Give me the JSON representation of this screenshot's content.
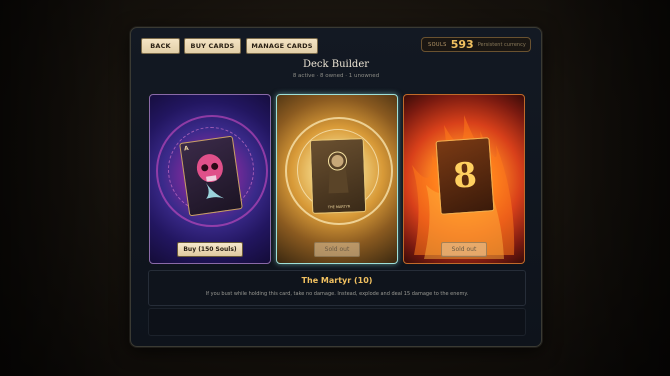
{
  "topbar": {
    "back_label": "BACK",
    "buy_label": "BUY CARDS",
    "manage_label": "MANAGE CARDS"
  },
  "souls": {
    "label": "SOULS",
    "count": "593",
    "currency_note": "Persistent currency"
  },
  "header": {
    "title": "Deck Builder",
    "subtitle": "8 active · 8 owned · 1 unowned"
  },
  "cards": [
    {
      "art": "skull-spirit-card",
      "button_label": "Buy (150 Souls)",
      "state": "buy",
      "rank": "A"
    },
    {
      "art": "martyr-card",
      "button_label": "Sold out",
      "state": "soldout",
      "rank": "THE MARTYR"
    },
    {
      "art": "flame-eight-card",
      "button_label": "Sold out",
      "state": "soldout",
      "rank": "8"
    }
  ],
  "selected": {
    "name": "The Martyr (10)",
    "description": "If you bust while holding this card, take no damage. Instead, explode and deal 15 damage to the enemy."
  },
  "colors": {
    "accent_gold": "#f0c060",
    "button_cream": "#f4e4c4",
    "panel_bg": "#131923"
  }
}
